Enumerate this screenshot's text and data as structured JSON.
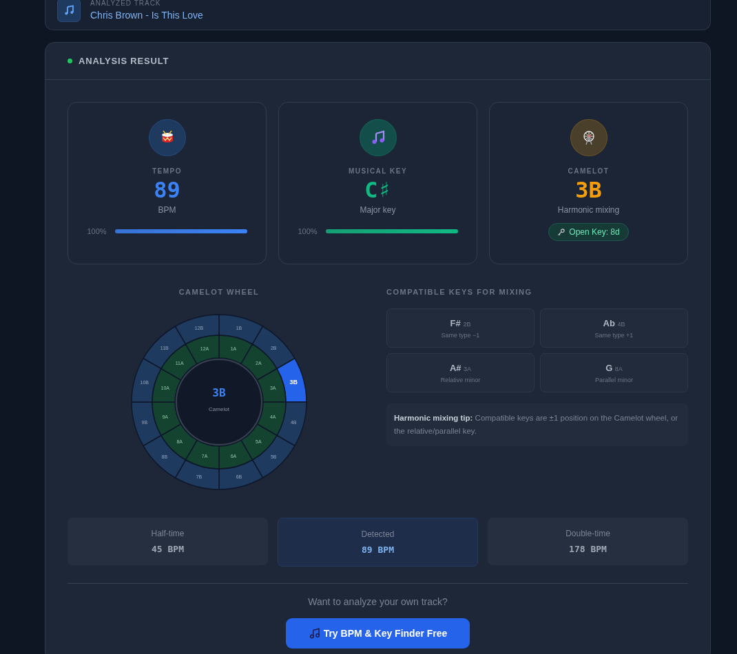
{
  "track": {
    "label": "ANALYZED TRACK",
    "title": "Chris Brown - Is This Love"
  },
  "result": {
    "title": "ANALYSIS RESULT",
    "stats": [
      {
        "kind": "tempo",
        "label": "TEMPO",
        "value": "89",
        "unit": "BPM",
        "confidence": "100%",
        "level": 1
      },
      {
        "kind": "key",
        "label": "MUSICAL KEY",
        "value": "C♯",
        "unit": "Major key",
        "confidence": "100%",
        "level": 1
      },
      {
        "kind": "camelot",
        "label": "CAMELOT",
        "value": "3B",
        "unit": "Harmonic mixing",
        "badge": "Open Key: 8d"
      }
    ],
    "wheel": {
      "title": "CAMELOT WHEEL",
      "center_value": "3B",
      "center_label": "Camelot",
      "outer": [
        {
          "label": "1B",
          "selected": false
        },
        {
          "label": "2B",
          "selected": false
        },
        {
          "label": "3B",
          "selected": true
        },
        {
          "label": "4B",
          "selected": false
        },
        {
          "label": "5B",
          "selected": false
        },
        {
          "label": "6B",
          "selected": false
        },
        {
          "label": "7B",
          "selected": false
        },
        {
          "label": "8B",
          "selected": false
        },
        {
          "label": "9B",
          "selected": false
        },
        {
          "label": "10B",
          "selected": false
        },
        {
          "label": "11B",
          "selected": false
        },
        {
          "label": "12B",
          "selected": false
        }
      ],
      "inner": [
        {
          "label": "1A",
          "selected": false
        },
        {
          "label": "2A",
          "selected": false
        },
        {
          "label": "3A",
          "selected": false
        },
        {
          "label": "4A",
          "selected": false
        },
        {
          "label": "5A",
          "selected": false
        },
        {
          "label": "6A",
          "selected": false
        },
        {
          "label": "7A",
          "selected": false
        },
        {
          "label": "8A",
          "selected": false
        },
        {
          "label": "9A",
          "selected": false
        },
        {
          "label": "10A",
          "selected": false
        },
        {
          "label": "11A",
          "selected": false
        },
        {
          "label": "12A",
          "selected": false
        }
      ]
    },
    "compatible": {
      "title": "COMPATIBLE KEYS FOR MIXING",
      "keys": [
        {
          "key": "F#",
          "code": "2B",
          "note": "Same type −1"
        },
        {
          "key": "Ab",
          "code": "4B",
          "note": "Same type +1"
        },
        {
          "key": "A#",
          "code": "3A",
          "note": "Relative minor"
        },
        {
          "key": "G",
          "code": "8A",
          "note": "Parallel minor"
        }
      ],
      "tip": "**Harmonic mixing tip:** Compatible keys are ±1 position on the Camelot wheel, or the relative/parallel key."
    },
    "tempo_variants": [
      {
        "label": "Half-time",
        "value": "45 BPM",
        "selected": false
      },
      {
        "label": "Detected",
        "value": "89 BPM",
        "selected": true
      },
      {
        "label": "Double-time",
        "value": "178 BPM",
        "selected": false
      }
    ],
    "cta": {
      "prompt": "Want to analyze your own track?",
      "button": "Try BPM & Key Finder Free"
    }
  }
}
